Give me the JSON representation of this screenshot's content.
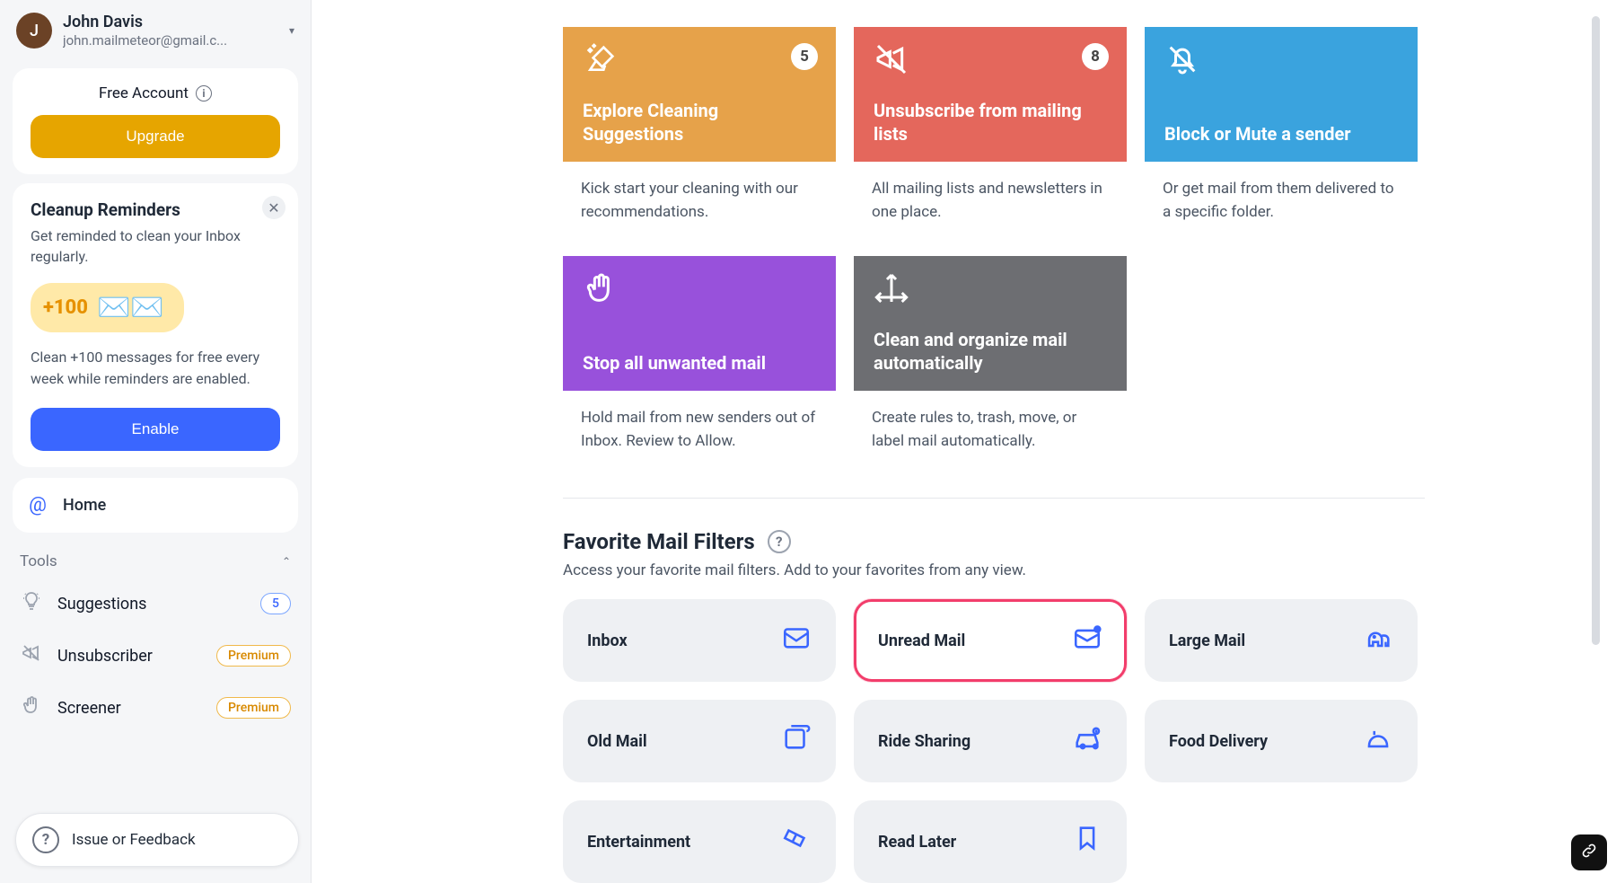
{
  "profile": {
    "initial": "J",
    "name": "John Davis",
    "email": "john.mailmeteor@gmail.c..."
  },
  "account": {
    "label": "Free Account",
    "upgrade": "Upgrade"
  },
  "reminders": {
    "title": "Cleanup Reminders",
    "subtitle": "Get reminded to clean your Inbox regularly.",
    "bonus": "+100",
    "body": "Clean +100 messages for free every week while reminders are enabled.",
    "enable": "Enable"
  },
  "sidebar": {
    "home": "Home",
    "tools_label": "Tools",
    "items": [
      {
        "label": "Suggestions",
        "badge_type": "count",
        "badge": "5"
      },
      {
        "label": "Unsubscriber",
        "badge_type": "premium",
        "badge": "Premium"
      },
      {
        "label": "Screener",
        "badge_type": "premium",
        "badge": "Premium"
      }
    ]
  },
  "feedback": "Issue or Feedback",
  "actions": [
    {
      "title": "Explore Cleaning Suggestions",
      "desc": "Kick start your cleaning with our recommendations.",
      "badge": "5",
      "color": "orange",
      "icon": "sparkle-broom"
    },
    {
      "title": "Unsubscribe from mailing lists",
      "desc": "All mailing lists and newsletters in one place.",
      "badge": "8",
      "color": "red",
      "icon": "megaphone-off"
    },
    {
      "title": "Block or Mute a sender",
      "desc": "Or get mail from them delivered to a specific folder.",
      "badge": "",
      "color": "blue",
      "icon": "bell-off"
    },
    {
      "title": "Stop all unwanted mail",
      "desc": "Hold mail from new senders out of Inbox. Review to Allow.",
      "badge": "",
      "color": "purple",
      "icon": "hand"
    },
    {
      "title": "Clean and organize mail automatically",
      "desc": "Create rules to, trash, move, or label mail automatically.",
      "badge": "",
      "color": "gray",
      "icon": "arrows"
    }
  ],
  "filters": {
    "title": "Favorite Mail Filters",
    "subtitle": "Access your favorite mail filters. Add to your favorites from any view.",
    "items": [
      {
        "label": "Inbox",
        "icon": "inbox",
        "highlight": false
      },
      {
        "label": "Unread Mail",
        "icon": "unread",
        "highlight": true
      },
      {
        "label": "Large Mail",
        "icon": "elephant",
        "highlight": false
      },
      {
        "label": "Old Mail",
        "icon": "old",
        "highlight": false
      },
      {
        "label": "Ride Sharing",
        "icon": "car",
        "highlight": false
      },
      {
        "label": "Food Delivery",
        "icon": "food",
        "highlight": false
      },
      {
        "label": "Entertainment",
        "icon": "ticket",
        "highlight": false
      },
      {
        "label": "Read Later",
        "icon": "bookmark",
        "highlight": false
      }
    ]
  }
}
